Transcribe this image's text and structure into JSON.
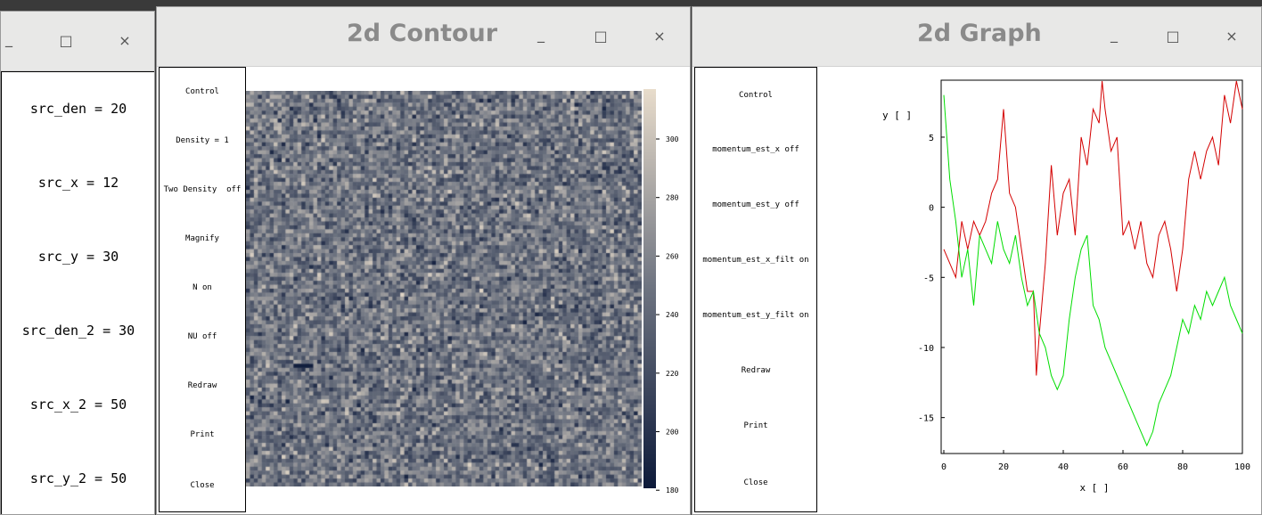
{
  "left_window": {
    "minimize": "_",
    "maximize": "□",
    "close": "×",
    "params": [
      "src_den = 20",
      "src_x = 12",
      "src_y = 30",
      "src_den_2 = 30",
      "src_x_2 = 50",
      "src_y_2 = 50"
    ]
  },
  "contour_window": {
    "title": "2d Contour",
    "minimize": "_",
    "maximize": "□",
    "close": "×",
    "buttons": [
      "Control",
      "Density = 1",
      "Two Density  off",
      "Magnify",
      "N on",
      "NU off",
      "Redraw",
      "Print",
      "Close"
    ],
    "colorbar_ticks": [
      "300",
      "280",
      "260",
      "240",
      "220",
      "200",
      "180"
    ],
    "colors": {
      "low": "#0d1a3a",
      "mid": "#6d7380",
      "high": "#e8dccb"
    }
  },
  "graph_window": {
    "title": "2d Graph",
    "minimize": "_",
    "maximize": "□",
    "close": "×",
    "buttons": [
      "Control",
      "momentum_est_x off",
      "momentum_est_y off",
      "momentum_est_x_filt on",
      "momentum_est_y_filt on",
      "Redraw",
      "Print",
      "Close"
    ]
  },
  "chart_data": {
    "type": "line",
    "xlabel": "x [ ]",
    "ylabel": "y [ ]",
    "xlim": [
      0,
      100
    ],
    "ylim": [
      -17.5,
      9
    ],
    "xticks": [
      0,
      20,
      40,
      60,
      80,
      100
    ],
    "yticks": [
      5,
      0,
      -5,
      -10,
      -15
    ],
    "series": [
      {
        "color": "#d40000",
        "x": [
          0,
          2,
          4,
          6,
          8,
          10,
          12,
          14,
          16,
          18,
          20,
          22,
          24,
          26,
          28,
          30,
          31,
          32,
          34,
          36,
          38,
          40,
          42,
          44,
          46,
          48,
          50,
          52,
          53,
          54,
          56,
          58,
          60,
          62,
          64,
          66,
          68,
          70,
          72,
          74,
          76,
          78,
          80,
          82,
          84,
          86,
          88,
          90,
          92,
          94,
          96,
          98,
          100
        ],
        "y": [
          -3,
          -4,
          -5,
          -1,
          -3,
          -1,
          -2,
          -1,
          1,
          2,
          7,
          1,
          0,
          -3,
          -6,
          -6,
          -12,
          -9,
          -4,
          3,
          -2,
          1,
          2,
          -2,
          5,
          3,
          7,
          6,
          9,
          7,
          4,
          5,
          -2,
          -1,
          -3,
          -1,
          -4,
          -5,
          -2,
          -1,
          -3,
          -6,
          -3,
          2,
          4,
          2,
          4,
          5,
          3,
          8,
          6,
          9,
          7
        ]
      },
      {
        "color": "#00dd00",
        "x": [
          0,
          2,
          4,
          6,
          8,
          10,
          12,
          14,
          16,
          18,
          20,
          22,
          24,
          26,
          28,
          30,
          32,
          34,
          36,
          38,
          40,
          42,
          44,
          46,
          48,
          50,
          52,
          54,
          56,
          58,
          60,
          62,
          64,
          66,
          68,
          70,
          72,
          74,
          76,
          78,
          80,
          82,
          84,
          86,
          88,
          90,
          92,
          94,
          96,
          98,
          100
        ],
        "y": [
          8,
          2,
          -1,
          -5,
          -3,
          -7,
          -2,
          -3,
          -4,
          -1,
          -3,
          -4,
          -2,
          -5,
          -7,
          -6,
          -9,
          -10,
          -12,
          -13,
          -12,
          -8,
          -5,
          -3,
          -2,
          -7,
          -8,
          -10,
          -11,
          -12,
          -13,
          -14,
          -15,
          -16,
          -17,
          -16,
          -14,
          -13,
          -12,
          -10,
          -8,
          -9,
          -7,
          -8,
          -6,
          -7,
          -6,
          -5,
          -7,
          -8,
          -9
        ]
      }
    ]
  }
}
